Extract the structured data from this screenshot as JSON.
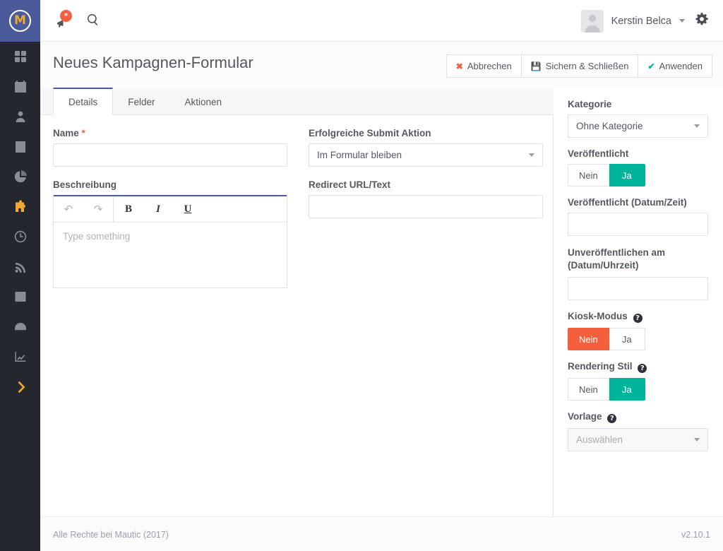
{
  "brand": {
    "logo_letter": "M",
    "name": "Mautic"
  },
  "topbar": {
    "notifications": {
      "icon": "bell-icon",
      "badge": "*"
    },
    "search": {
      "icon": "search-icon"
    },
    "user": {
      "name": "Kerstin Belca",
      "avatar_icon": "user-avatar-icon",
      "caret_icon": "chevron-down-icon"
    },
    "settings": {
      "icon": "gear-icon"
    }
  },
  "sidebar": {
    "items": [
      {
        "icon": "dashboard-grid-icon",
        "active": false
      },
      {
        "icon": "calendar-icon",
        "active": false
      },
      {
        "icon": "contacts-person-icon",
        "active": false
      },
      {
        "icon": "company-building-icon",
        "active": false
      },
      {
        "icon": "pie-chart-icon",
        "active": false
      },
      {
        "icon": "puzzle-piece-icon",
        "active": true
      },
      {
        "icon": "clock-icon",
        "active": false
      },
      {
        "icon": "rss-feed-icon",
        "active": false
      },
      {
        "icon": "table-grid-icon",
        "active": false
      },
      {
        "icon": "gauge-icon",
        "active": false
      },
      {
        "icon": "line-chart-icon",
        "active": false
      }
    ],
    "expander": {
      "icon": "chevron-right-icon"
    }
  },
  "page": {
    "title": "Neues Kampagnen-Formular"
  },
  "actions": [
    {
      "label": "Abbrechen",
      "icon": "close-x-icon"
    },
    {
      "label": "Sichern & Schließen",
      "icon": "save-disk-icon"
    },
    {
      "label": "Anwenden",
      "icon": "check-icon"
    }
  ],
  "tabs": [
    {
      "label": "Details",
      "active": true
    },
    {
      "label": "Felder",
      "active": false
    },
    {
      "label": "Aktionen",
      "active": false
    }
  ],
  "form": {
    "name": {
      "label": "Name",
      "required_marker": "*",
      "value": "",
      "placeholder": ""
    },
    "description": {
      "label": "Beschreibung",
      "placeholder": "Type something",
      "value": "",
      "toolbar": [
        {
          "name": "undo-icon",
          "glyph": "↶"
        },
        {
          "name": "redo-icon",
          "glyph": "↷"
        },
        {
          "name": "bold-icon",
          "glyph": "B"
        },
        {
          "name": "italic-icon",
          "glyph": "I"
        },
        {
          "name": "underline-icon",
          "glyph": "U"
        }
      ]
    },
    "submit_action": {
      "label": "Erfolgreiche Submit Aktion",
      "value": "Im Formular bleiben"
    },
    "redirect": {
      "label": "Redirect URL/Text",
      "value": "",
      "placeholder": ""
    }
  },
  "panel": {
    "category": {
      "label": "Kategorie",
      "value": "Ohne Kategorie"
    },
    "published": {
      "label": "Veröffentlicht",
      "no": "Nein",
      "yes": "Ja",
      "selected": "yes"
    },
    "publish_at": {
      "label": "Veröffentlicht (Datum/Zeit)",
      "value": "",
      "placeholder": ""
    },
    "unpublish_at": {
      "label": "Unveröffentlichen am (Datum/Uhrzeit)",
      "value": "",
      "placeholder": ""
    },
    "kiosk_mode": {
      "label": "Kiosk-Modus",
      "help": "?",
      "no": "Nein",
      "yes": "Ja",
      "selected": "no"
    },
    "render_style": {
      "label": "Rendering Stil",
      "help": "?",
      "no": "Nein",
      "yes": "Ja",
      "selected": "yes"
    },
    "template": {
      "label": "Vorlage",
      "help": "?",
      "value": "Auswählen",
      "disabled": true
    }
  },
  "footer": {
    "copyright": "Alle Rechte bei Mautic (2017)",
    "version": "v2.10.1"
  },
  "colors": {
    "brand_blue": "#4b5b9a",
    "sidebar_dark": "#25272f",
    "accent_yellow": "#f0a830",
    "success_teal": "#00b49c",
    "danger_orange": "#f4603e",
    "text": "#55585f",
    "border": "#dfe1e4"
  }
}
